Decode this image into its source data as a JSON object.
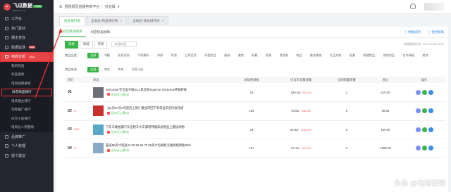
{
  "logo": {
    "title": "飞瓜数据",
    "sub": "FEIGUA.CN",
    "badge": "抖音版"
  },
  "sidebar": {
    "items": [
      {
        "label": "工作台"
      },
      {
        "label": "热门素材",
        "arrow": "›"
      },
      {
        "label": "播主查找",
        "arrow": "›"
      },
      {
        "label": "数据监测",
        "badge": "New",
        "arrow": "›"
      }
    ],
    "active_group": {
      "label": "电商分析",
      "badge": "New",
      "arrow": "⌄"
    },
    "sub_items": [
      "我的商品",
      "商品搜索",
      "电商视频搜索",
      "抖音商品排行",
      "电商播主排行",
      "淘客推广排行",
      "抖音小店排行",
      "电商达人销量榜"
    ],
    "current_sub": 3,
    "bottom_items": [
      {
        "label": "品牌推广",
        "arrow": "›"
      },
      {
        "label": "个人管理",
        "arrow": "›"
      },
      {
        "label": "提个建议"
      }
    ]
  },
  "topbar": {
    "crumb1": "短视频及直播电商平台",
    "crumb2": "抖音版"
  },
  "tabs": [
    {
      "label": "商品排行榜",
      "active": true
    },
    {
      "label": "全局总-商品排行榜"
    },
    {
      "label": "全局总-商品排行榜"
    }
  ],
  "subtabs": [
    {
      "label": "抖音带货榜单",
      "active": true
    },
    {
      "label": "抖音热卖榜单"
    }
  ],
  "help": [
    "数据说明",
    "使用帮助"
  ],
  "date": {
    "buttons": [
      "日榜",
      "周榜",
      "月榜"
    ],
    "active": 0,
    "value": "11月05日",
    "updated": "数据更新时间：2019-11-06 04:00"
  },
  "category": {
    "label": "商品品类",
    "chips": [
      "全部",
      "书籍",
      "家居家纺",
      "手机数码",
      "护肤",
      "彩妆",
      "日用百货",
      "母婴用品",
      "服装",
      "美食",
      "鞋靴",
      "男装",
      "男女鞋",
      "饰品",
      "美发美妆",
      "礼品文娱",
      "医美",
      "保健食品",
      "宠物用品",
      "花鸟绿植",
      "其他"
    ]
  },
  "source": {
    "label": "商品来源",
    "chips": [
      "全部",
      "淘宝",
      "京东",
      "抖音小店"
    ]
  },
  "table": {
    "headers": [
      "排行",
      "商品",
      "关联视频数",
      "抖音浏览量增量",
      "全网销量增量",
      "售价",
      "操作"
    ],
    "rows": [
      {
        "rank": "01",
        "change": "",
        "change_dir": "",
        "name": "W3Caviar宝贝盒子极No.2黑金新Superior Oscletrax神秘转账",
        "link": "近90天上榜0次",
        "videos": "15",
        "views": "156.4w",
        "views_chg": "534.2%",
        "sales": "1",
        "price": "418.00"
      },
      {
        "rank": "02",
        "change": "17",
        "change_dir": "up",
        "name": "【11月04号0点前后上新】赠品带回下单到当天后同发快递",
        "link": "近90天上榜0次",
        "videos": "166",
        "views": "76.6w",
        "views_chg": "1152.3%",
        "sales": "0",
        "price": "89.00"
      },
      {
        "rank": "03",
        "change": "1871",
        "change_dir": "up",
        "name": "汽车车载拍摄汽车出租车大车都用神器家居用品上赠送动物",
        "link": "近90天上榜0次",
        "videos": "34",
        "views": "64.5w",
        "views_chg": "11402.2%",
        "sales": "2",
        "price": "159.00"
      },
      {
        "rank": "04",
        "change": "17",
        "change_dir": "up",
        "name": "霸道55英寸液晶42 50 60 65 75 85英寸电视机无线网络智能WiFi",
        "link": "近90天上榜0次",
        "videos": "107",
        "views": "37.7w",
        "views_chg": "1107.3%",
        "sales": "1",
        "price": "1899.00"
      }
    ]
  },
  "watermark": "头条 @电商营销"
}
